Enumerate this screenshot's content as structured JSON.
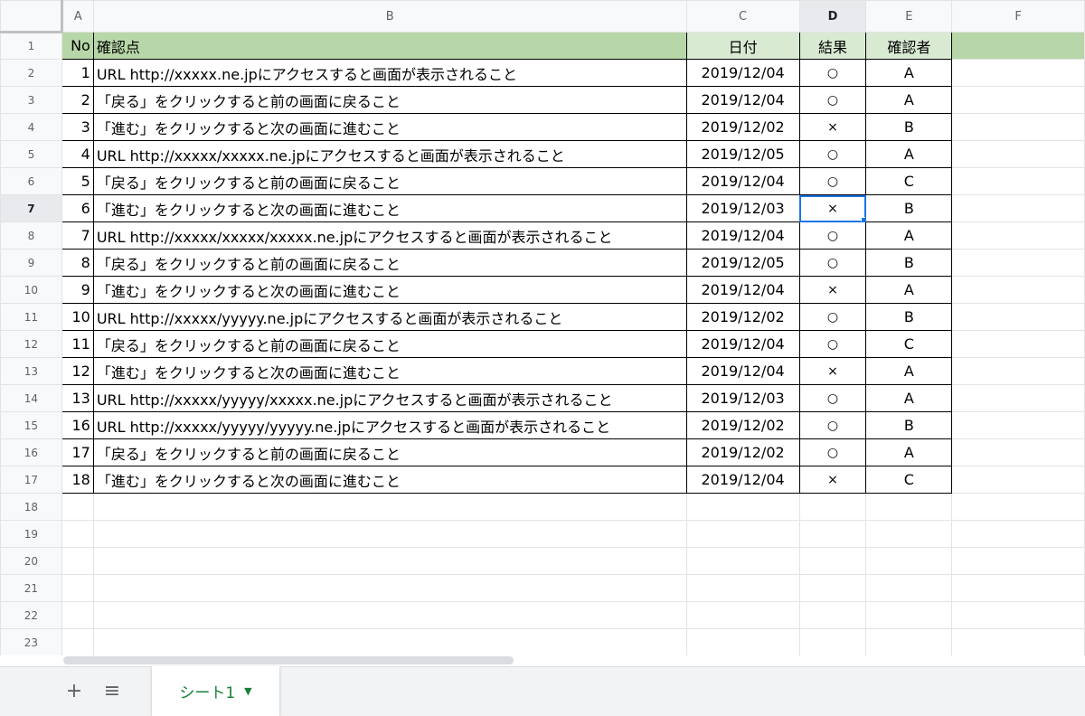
{
  "columns": [
    "A",
    "B",
    "C",
    "D",
    "E",
    "F"
  ],
  "selected_column": "D",
  "selected_row": "7",
  "header": {
    "no": "No",
    "check": "確認点",
    "date": "日付",
    "result": "結果",
    "checker": "確認者"
  },
  "rows": [
    {
      "row": "2",
      "no": "1",
      "check": "URL http://xxxxx.ne.jpにアクセスすると画面が表示されること",
      "date": "2019/12/04",
      "result": "○",
      "checker": "A"
    },
    {
      "row": "3",
      "no": "2",
      "check": "「戻る」をクリックすると前の画面に戻ること",
      "date": "2019/12/04",
      "result": "○",
      "checker": "A"
    },
    {
      "row": "4",
      "no": "3",
      "check": "「進む」をクリックすると次の画面に進むこと",
      "date": "2019/12/02",
      "result": "×",
      "checker": "B"
    },
    {
      "row": "5",
      "no": "4",
      "check": "URL http://xxxxx/xxxxx.ne.jpにアクセスすると画面が表示されること",
      "date": "2019/12/05",
      "result": "○",
      "checker": "A"
    },
    {
      "row": "6",
      "no": "5",
      "check": "「戻る」をクリックすると前の画面に戻ること",
      "date": "2019/12/04",
      "result": "○",
      "checker": "C"
    },
    {
      "row": "7",
      "no": "6",
      "check": "「進む」をクリックすると次の画面に進むこと",
      "date": "2019/12/03",
      "result": "×",
      "checker": "B"
    },
    {
      "row": "8",
      "no": "7",
      "check": "URL http://xxxxx/xxxxx/xxxxx.ne.jpにアクセスすると画面が表示されること",
      "date": "2019/12/04",
      "result": "○",
      "checker": "A"
    },
    {
      "row": "9",
      "no": "8",
      "check": "「戻る」をクリックすると前の画面に戻ること",
      "date": "2019/12/05",
      "result": "○",
      "checker": "B"
    },
    {
      "row": "10",
      "no": "9",
      "check": "「進む」をクリックすると次の画面に進むこと",
      "date": "2019/12/04",
      "result": "×",
      "checker": "A"
    },
    {
      "row": "11",
      "no": "10",
      "check": "URL http://xxxxx/yyyyy.ne.jpにアクセスすると画面が表示されること",
      "date": "2019/12/02",
      "result": "○",
      "checker": "B"
    },
    {
      "row": "12",
      "no": "11",
      "check": "「戻る」をクリックすると前の画面に戻ること",
      "date": "2019/12/04",
      "result": "○",
      "checker": "C"
    },
    {
      "row": "13",
      "no": "12",
      "check": "「進む」をクリックすると次の画面に進むこと",
      "date": "2019/12/04",
      "result": "×",
      "checker": "A"
    },
    {
      "row": "14",
      "no": "13",
      "check": "URL http://xxxxx/yyyyy/xxxxx.ne.jpにアクセスすると画面が表示されること",
      "date": "2019/12/03",
      "result": "○",
      "checker": "A"
    },
    {
      "row": "15",
      "no": "16",
      "check": "URL http://xxxxx/yyyyy/yyyyy.ne.jpにアクセスすると画面が表示されること",
      "date": "2019/12/02",
      "result": "○",
      "checker": "B"
    },
    {
      "row": "16",
      "no": "17",
      "check": "「戻る」をクリックすると前の画面に戻ること",
      "date": "2019/12/02",
      "result": "○",
      "checker": "A"
    },
    {
      "row": "17",
      "no": "18",
      "check": "「進む」をクリックすると次の画面に進むこと",
      "date": "2019/12/04",
      "result": "×",
      "checker": "C"
    }
  ],
  "empty_rows": [
    "18",
    "19",
    "20",
    "21",
    "22",
    "23"
  ],
  "tabbar": {
    "add_icon": "plus-icon",
    "add_glyph": "+",
    "menu_icon": "list-icon",
    "menu_glyph": "≡",
    "sheet_tab": "シート1",
    "tab_arrow_glyph": "▼"
  },
  "colors": {
    "header_fill": "#b7d7a8",
    "header_fill_right": "#d9ead3",
    "selection": "#1a73e8",
    "tab_text": "#188038"
  }
}
